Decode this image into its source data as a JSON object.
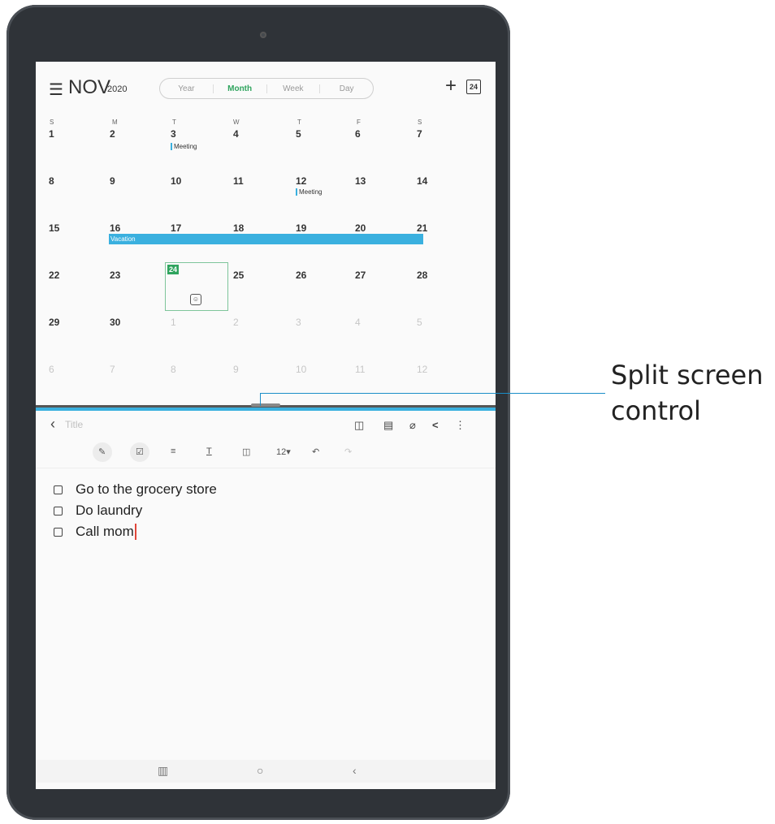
{
  "calendar": {
    "month": "NOV",
    "year": "2020",
    "view_tabs": [
      "Year",
      "Month",
      "Week",
      "Day"
    ],
    "active_tab": "Month",
    "today_badge": "24",
    "weekdays": [
      "S",
      "M",
      "T",
      "W",
      "T",
      "F",
      "S"
    ],
    "weeks": [
      [
        "1",
        "2",
        "3",
        "4",
        "5",
        "6",
        "7"
      ],
      [
        "8",
        "9",
        "10",
        "11",
        "12",
        "13",
        "14"
      ],
      [
        "15",
        "16",
        "17",
        "18",
        "19",
        "20",
        "21"
      ],
      [
        "22",
        "23",
        "24",
        "25",
        "26",
        "27",
        "28"
      ],
      [
        "29",
        "30",
        "1",
        "2",
        "3",
        "4",
        "5"
      ],
      [
        "6",
        "7",
        "8",
        "9",
        "10",
        "11",
        "12"
      ]
    ],
    "events": {
      "meeting_1": "Meeting",
      "meeting_2": "Meeting",
      "vacation": "Vacation"
    }
  },
  "notes": {
    "title_placeholder": "Title",
    "font_size": "12",
    "items": [
      "Go to the grocery store",
      "Do laundry",
      "Call mom"
    ]
  },
  "annotation": {
    "line1": "Split screen",
    "line2": "control"
  },
  "colors": {
    "accent_blue": "#3ab0df",
    "accent_green": "#2fa45e",
    "cursor": "#e0463a"
  }
}
